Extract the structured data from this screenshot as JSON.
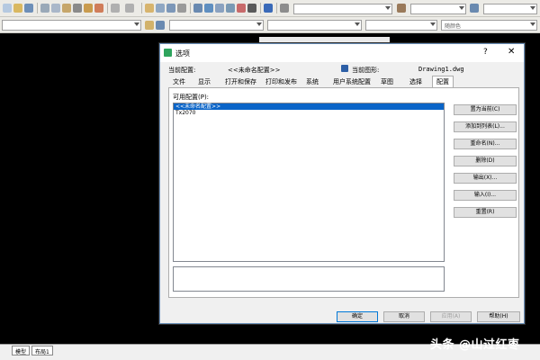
{
  "toolbar": {
    "layer_placeholder": "",
    "color_label": "随颜色"
  },
  "dialog": {
    "title": "选项",
    "help_glyph": "?",
    "close_glyph": "✕",
    "current_profile_label": "当前配置:",
    "current_profile_value": "<<未命名配置>>",
    "current_drawing_label": "当前图形:",
    "current_drawing_value": "Drawing1.dwg",
    "tabs": [
      "文件",
      "显示",
      "打开和保存",
      "打印和发布",
      "系统",
      "用户系统配置",
      "草图",
      "选择",
      "配置"
    ],
    "active_tab": "配置",
    "available_profiles_label": "可用配置(P):",
    "profiles": [
      "<<未命名配置>>",
      "Tx2070"
    ],
    "selected_profile": "<<未命名配置>>",
    "side_buttons": [
      "置为当前(C)",
      "添加到列表(L)...",
      "重命名(N)...",
      "删除(D)",
      "输出(X)...",
      "输入(I)...",
      "重置(R)"
    ],
    "footer_buttons": {
      "ok": "确定",
      "cancel": "取消",
      "apply": "应用(A)",
      "help": "帮助(H)"
    }
  },
  "bottom_tabs": [
    "模型",
    "布局1"
  ],
  "watermark": "头条 @山过红枣"
}
